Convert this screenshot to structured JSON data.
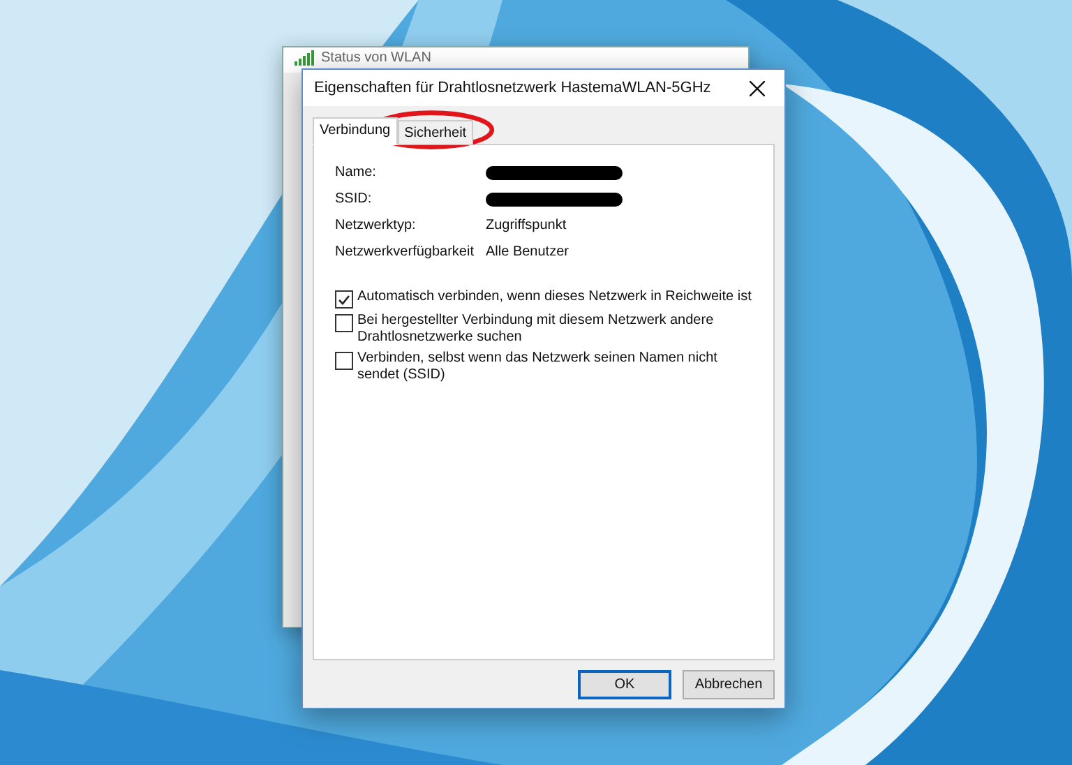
{
  "background_window": {
    "title": "Status von WLAN"
  },
  "dialog": {
    "title": "Eigenschaften für Drahtlosnetzwerk HastemaWLAN-5GHz"
  },
  "tabs": [
    {
      "label": "Verbindung",
      "selected": true
    },
    {
      "label": "Sicherheit",
      "selected": false
    }
  ],
  "properties": [
    {
      "label": "Name:",
      "kind": "redacted"
    },
    {
      "label": "SSID:",
      "kind": "redacted"
    },
    {
      "label": "Netzwerktyp:",
      "kind": "text",
      "value": "Zugriffspunkt"
    },
    {
      "label": "Netzwerkverfügbarkeit",
      "kind": "text",
      "value": "Alle Benutzer"
    }
  ],
  "options": [
    {
      "label": "Automatisch verbinden, wenn dieses Netzwerk in Reichweite ist",
      "checked": true
    },
    {
      "label": "Bei hergestellter Verbindung mit diesem Netzwerk andere Drahtlosnetzwerke suchen",
      "checked": false
    },
    {
      "label": "Verbinden, selbst wenn das Netzwerk seinen Namen nicht sendet (SSID)",
      "checked": false
    }
  ],
  "buttons": [
    {
      "label": "OK",
      "default": true
    },
    {
      "label": "Abbrechen",
      "default": false
    }
  ]
}
